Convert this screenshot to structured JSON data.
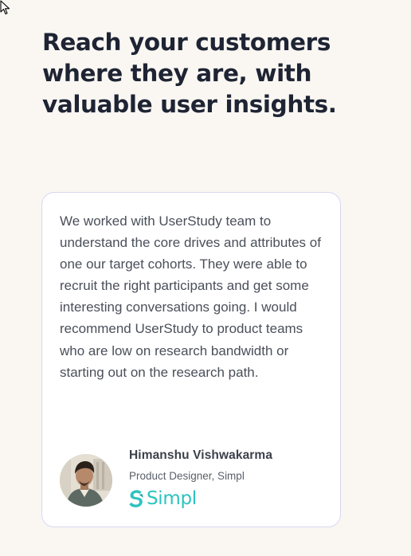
{
  "headline": "Reach your customers where they are, with valuable user insights.",
  "testimonial": {
    "quote": "We worked with UserStudy team to understand the core drives and attributes of one our target cohorts. They were able to recruit the right participants and get some interesting conversations going. I would recommend UserStudy to product teams who are low on research bandwidth or starting out on the research path.",
    "author_name": "Himanshu Vishwakarma",
    "author_role": "Product Designer, Simpl",
    "company_logo_text": "Simpl",
    "company_logo_icon": "simpl-s-icon",
    "company_color": "#2cc3c0"
  },
  "colors": {
    "page_background": "#faf7f3",
    "headline": "#1e2433",
    "card_border": "#d9d7f0"
  }
}
